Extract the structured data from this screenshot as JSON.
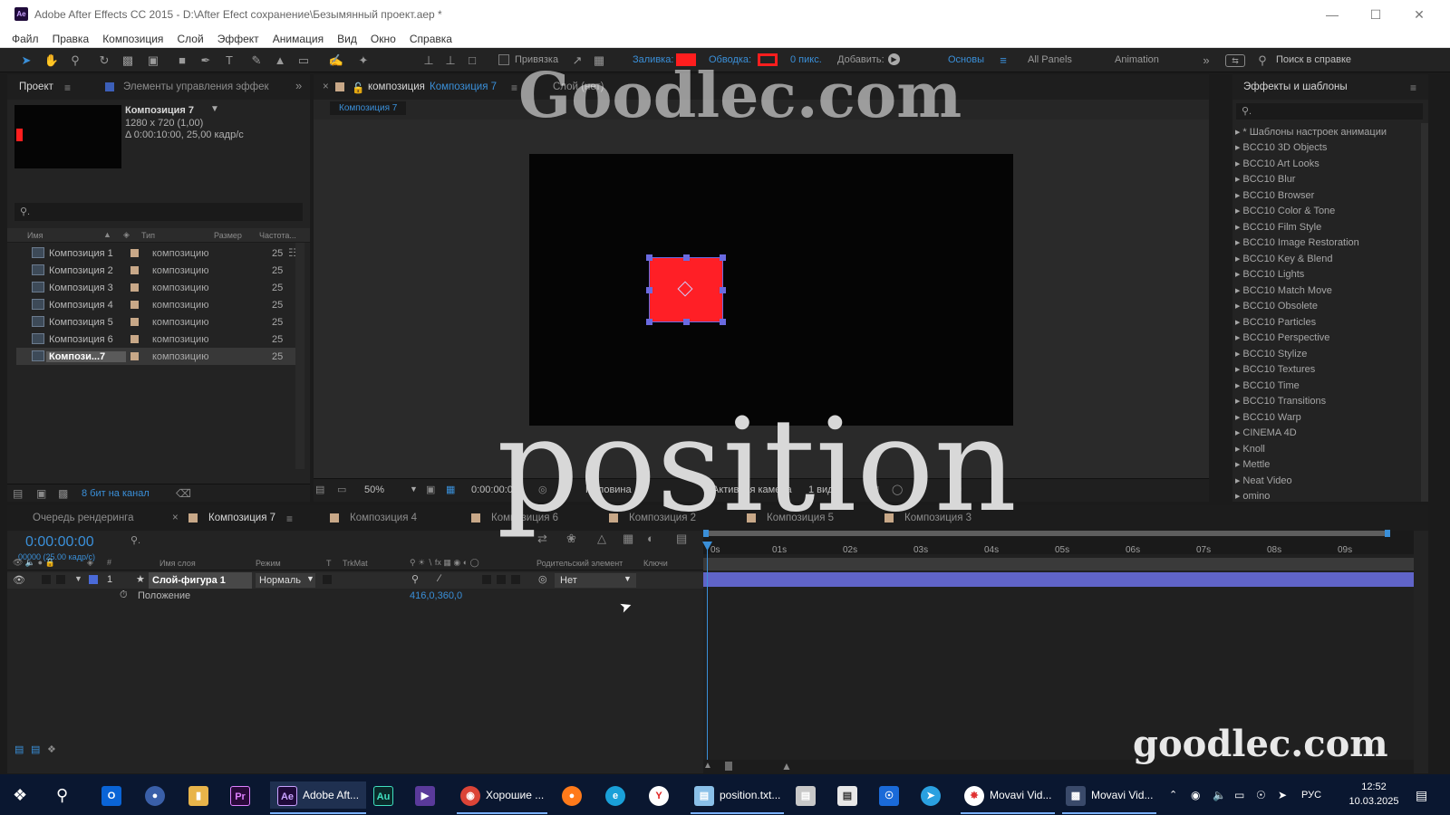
{
  "window": {
    "title": "Adobe After Effects CC 2015 - D:\\After Efect сохранение\\Безымянный проект.aep *",
    "app_icon": "Ae"
  },
  "menu": [
    "Файл",
    "Правка",
    "Композиция",
    "Слой",
    "Эффект",
    "Анимация",
    "Вид",
    "Окно",
    "Справка"
  ],
  "toolbar": {
    "snap_label": "Привязка",
    "fill_label": "Заливка:",
    "stroke_label": "Обводка:",
    "stroke_width": "0 пикс.",
    "add_label": "Добавить:",
    "workspaces": [
      "Основы",
      "All Panels",
      "Animation"
    ],
    "help_search": "Поиск в справке",
    "fill_color": "#ff1e1e",
    "stroke_color": "#ff1e1e"
  },
  "project_panel": {
    "tab_project": "Проект",
    "tab_effects": "Элементы управления эффек",
    "comp_name": "Композиция 7",
    "comp_size": "1280 x 720 (1,00)",
    "comp_duration": "Δ 0:00:10:00, 25,00 кадр/с",
    "col_name": "Имя",
    "col_type": "Тип",
    "col_size": "Размер",
    "col_rate": "Частота...",
    "items": [
      {
        "name": "Композиция 1",
        "type": "композицию",
        "rate": "25"
      },
      {
        "name": "Композиция 2",
        "type": "композицию",
        "rate": "25"
      },
      {
        "name": "Композиция 3",
        "type": "композицию",
        "rate": "25"
      },
      {
        "name": "Композиция 4",
        "type": "композицию",
        "rate": "25"
      },
      {
        "name": "Композиция 5",
        "type": "композицию",
        "rate": "25"
      },
      {
        "name": "Композиция 6",
        "type": "композицию",
        "rate": "25"
      },
      {
        "name": "Компози...7",
        "type": "композицию",
        "rate": "25"
      }
    ],
    "bit_depth": "8 бит на канал"
  },
  "comp_panel": {
    "tab_comp": "композиция",
    "tab_comp_name": "Композиция 7",
    "tab_layer": "Слой (нет)",
    "subtab": "Композиция 7",
    "zoom": "50%",
    "timecode": "0:00:00:00",
    "resolution": "Половина",
    "camera": "Активная камера",
    "views": "1 вид",
    "shape_color": "#ff1f26",
    "bg_color": "#050505"
  },
  "effects_panel": {
    "title": "Эффекты и шаблоны",
    "items": [
      "* Шаблоны настроек анимации",
      "BCC10 3D Objects",
      "BCC10 Art Looks",
      "BCC10 Blur",
      "BCC10 Browser",
      "BCC10 Color & Tone",
      "BCC10 Film Style",
      "BCC10 Image Restoration",
      "BCC10 Key & Blend",
      "BCC10 Lights",
      "BCC10 Match Move",
      "BCC10 Obsolete",
      "BCC10 Particles",
      "BCC10 Perspective",
      "BCC10 Stylize",
      "BCC10 Textures",
      "BCC10 Time",
      "BCC10 Transitions",
      "BCC10 Warp",
      "CINEMA 4D",
      "Knoll",
      "Mettle",
      "Neat Video",
      "omino"
    ]
  },
  "timeline": {
    "tabs": [
      "Очередь рендеринга",
      "Композиция 7",
      "Композиция 4",
      "Композиция 6",
      "Композиция 2",
      "Композиция 5",
      "Композиция 3"
    ],
    "timecode": "0:00:00:00",
    "frame_info": "00000 (25.00 кадр/с)",
    "col_layer_name": "Имя слоя",
    "col_mode": "Режим",
    "col_t": "T",
    "col_trkmat": "TrkMat",
    "col_parent": "Родительский элемент",
    "col_keys": "Ключи",
    "layer_index": "1",
    "layer_name": "Слой-фигура 1",
    "layer_mode": "Нормаль",
    "parent_value": "Нет",
    "property_name": "Положение",
    "property_value": "416,0,360,0",
    "ruler": [
      "0s",
      "01s",
      "02s",
      "03s",
      "04s",
      "05s",
      "06s",
      "07s",
      "08s",
      "09s"
    ],
    "layer_bar_color": "#6064c8"
  },
  "watermarks": {
    "top": "Goodlec.com",
    "center": "position",
    "bottom": "goodlec.com"
  },
  "taskbar": {
    "apps": [
      {
        "label": "",
        "icon": "outlook-icon"
      },
      {
        "label": "",
        "icon": "browser-icon"
      },
      {
        "label": "",
        "icon": "folder-icon"
      },
      {
        "label": "",
        "icon": "premiere-icon"
      },
      {
        "label": "Adobe Aft...",
        "icon": "after-effects-icon"
      },
      {
        "label": "",
        "icon": "audition-icon"
      },
      {
        "label": "",
        "icon": "visual-studio-icon"
      },
      {
        "label": "Хорошие ...",
        "icon": "chrome-icon"
      },
      {
        "label": "",
        "icon": "firefox-icon"
      },
      {
        "label": "",
        "icon": "edge-icon"
      },
      {
        "label": "",
        "icon": "yandex-icon"
      },
      {
        "label": "position.txt...",
        "icon": "notepad-icon"
      },
      {
        "label": "",
        "icon": "app-icon"
      },
      {
        "label": "",
        "icon": "app2-icon"
      },
      {
        "label": "",
        "icon": "shield-icon"
      },
      {
        "label": "",
        "icon": "telegram-icon"
      },
      {
        "label": "Movavi Vid...",
        "icon": "movavi-icon"
      },
      {
        "label": "Movavi Vid...",
        "icon": "movavi-editor-icon"
      }
    ],
    "language": "РУС",
    "time": "12:52",
    "date": "10.03.2025"
  }
}
